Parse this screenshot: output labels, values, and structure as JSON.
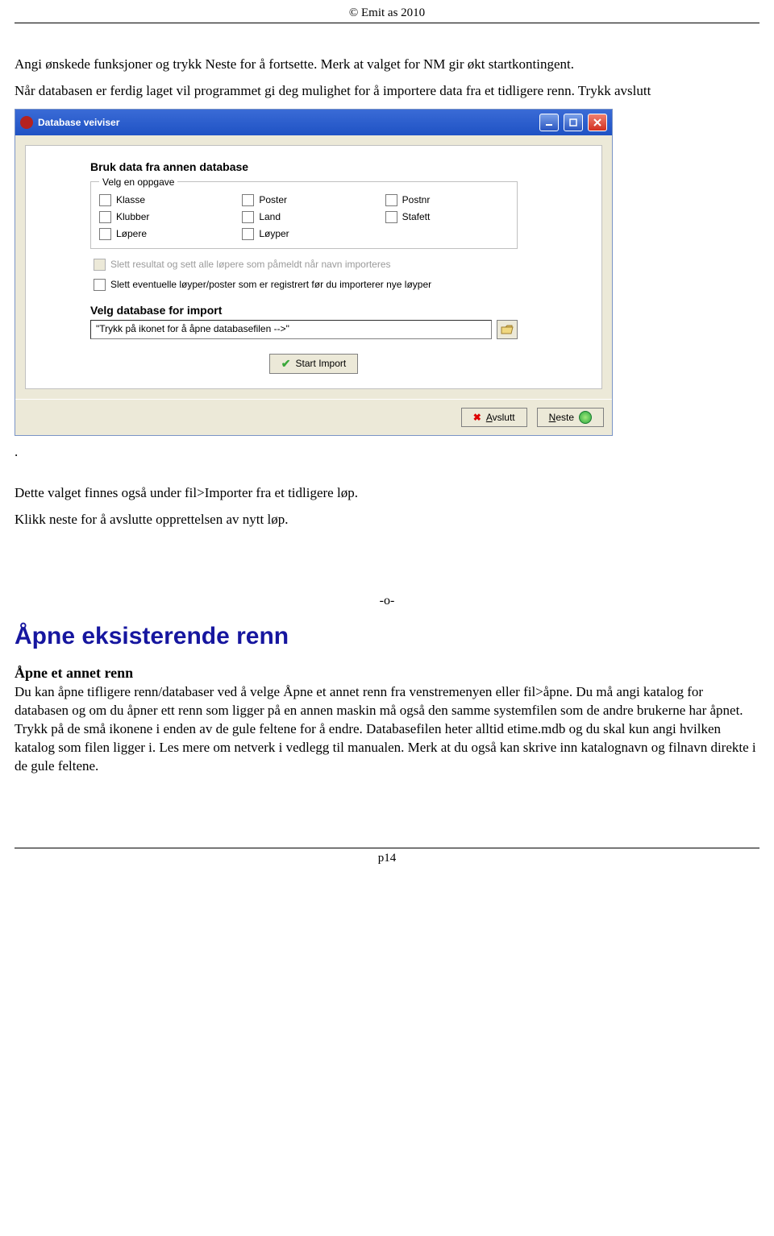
{
  "header": {
    "copyright": "© Emit as 2010"
  },
  "intro": {
    "p1": "Angi ønskede funksjoner og  trykk Neste for å fortsette. Merk at valget for NM gir økt startkontingent.",
    "p2": "Når databasen er ferdig laget vil programmet gi deg mulighet for å importere data fra et tidligere renn. Trykk avslutt"
  },
  "dialog": {
    "title": "Database veiviser",
    "section1": "Bruk data fra annen database",
    "fieldset_legend": "Velg en oppgave",
    "checkboxes": [
      "Klasse",
      "Poster",
      "Postnr",
      "Klubber",
      "Land",
      "Stafett",
      "Løpere",
      "Løyper"
    ],
    "disabled_line": "Slett resultat og sett alle løpere som påmeldt når navn importeres",
    "line2": "Slett eventuelle løyper/poster som er registrert før du importerer nye løyper",
    "section2": "Velg database for import",
    "input_value": "\"Trykk på ikonet for å åpne databasefilen -->\"",
    "start_button": "Start Import",
    "avslutt_button": "Avslutt",
    "neste_button": "Neste"
  },
  "after": {
    "dot": ".",
    "p3": "Dette valget finnes også under fil>Importer fra et tidligere løp.",
    "p4": "Klikk neste for å avslutte opprettelsen av nytt løp."
  },
  "divider": "-o-",
  "h1": "Åpne eksisterende renn",
  "subhead": "Åpne et annet renn",
  "paragraph2": "Du kan åpne tifligere renn/databaser ved å  velge Åpne et annet renn fra venstremenyen eller fil>åpne. Du må angi katalog for databasen og om du åpner ett renn som ligger på en annen maskin må også den samme systemfilen som de andre brukerne har åpnet. Trykk på de små ikonene i enden av de gule feltene for å endre. Databasefilen heter alltid etime.mdb og du skal kun angi hvilken katalog som filen ligger i.  Les mere om netverk i vedlegg til manualen. Merk at du også kan skrive inn katalognavn og filnavn direkte i de gule feltene.",
  "footer": {
    "page": "p14"
  }
}
